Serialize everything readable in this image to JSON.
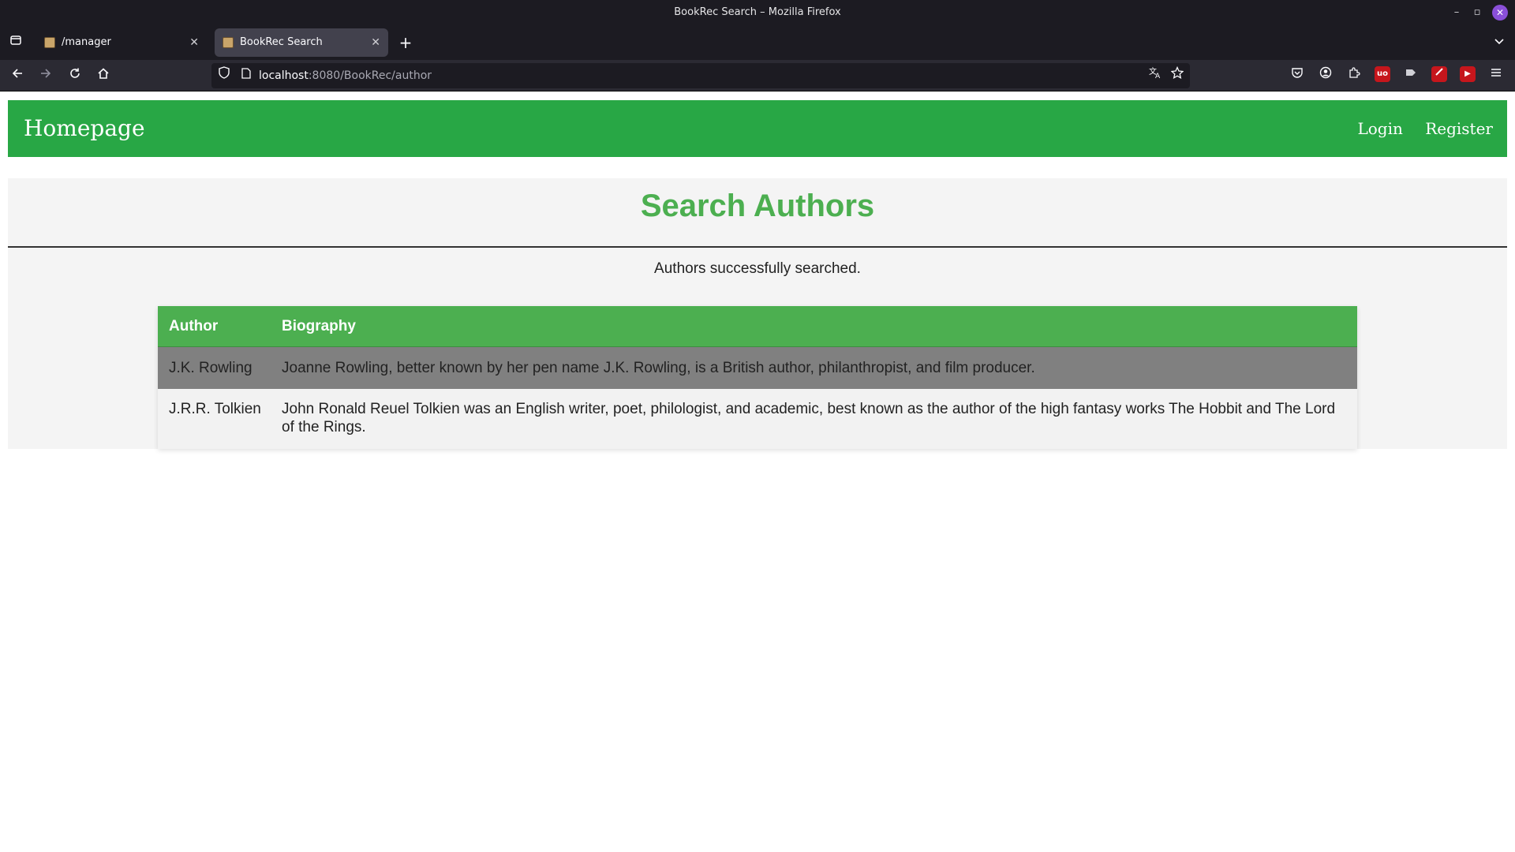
{
  "window": {
    "title": "BookRec Search – Mozilla Firefox",
    "controls": {
      "minimize": "–",
      "restore": "▫",
      "close": "✕"
    }
  },
  "tabs": [
    {
      "label": "/manager",
      "active": false
    },
    {
      "label": "BookRec Search",
      "active": true
    }
  ],
  "address_bar": {
    "host": "localhost",
    "path": ":8080/BookRec/author"
  },
  "icons": {
    "tab_overview": "tab-list-icon",
    "new_tab": "plus-icon",
    "list_all_tabs": "chevron-down-icon",
    "back": "back-arrow-icon",
    "forward": "forward-arrow-icon",
    "reload": "reload-icon",
    "home": "home-icon",
    "tracking_protection": "shield-icon",
    "page_info": "page-icon",
    "translate": "translate-icon",
    "bookmark": "star-icon",
    "pocket": "pocket-icon",
    "account": "account-icon",
    "extensions": "puzzle-icon",
    "ublock": "ublock-icon",
    "extension_gray": "extension-icon",
    "extension_red": "red-extension-icon",
    "youtube": "youtube-icon",
    "menu": "hamburger-menu-icon"
  },
  "site": {
    "brand": "Homepage",
    "nav": {
      "login": "Login",
      "register": "Register"
    },
    "brand_color": "#28a745"
  },
  "main": {
    "heading": "Search Authors",
    "heading_color": "#4caf50",
    "status_message": "Authors successfully searched."
  },
  "table": {
    "headers": {
      "author": "Author",
      "biography": "Biography"
    },
    "rows": [
      {
        "author": "J.K. Rowling",
        "biography": "Joanne Rowling, better known by her pen name J.K. Rowling, is a British author, philanthropist, and film producer."
      },
      {
        "author": "J.R.R. Tolkien",
        "biography": "John Ronald Reuel Tolkien was an English writer, poet, philologist, and academic, best known as the author of the high fantasy works The Hobbit and The Lord of the Rings."
      }
    ]
  }
}
